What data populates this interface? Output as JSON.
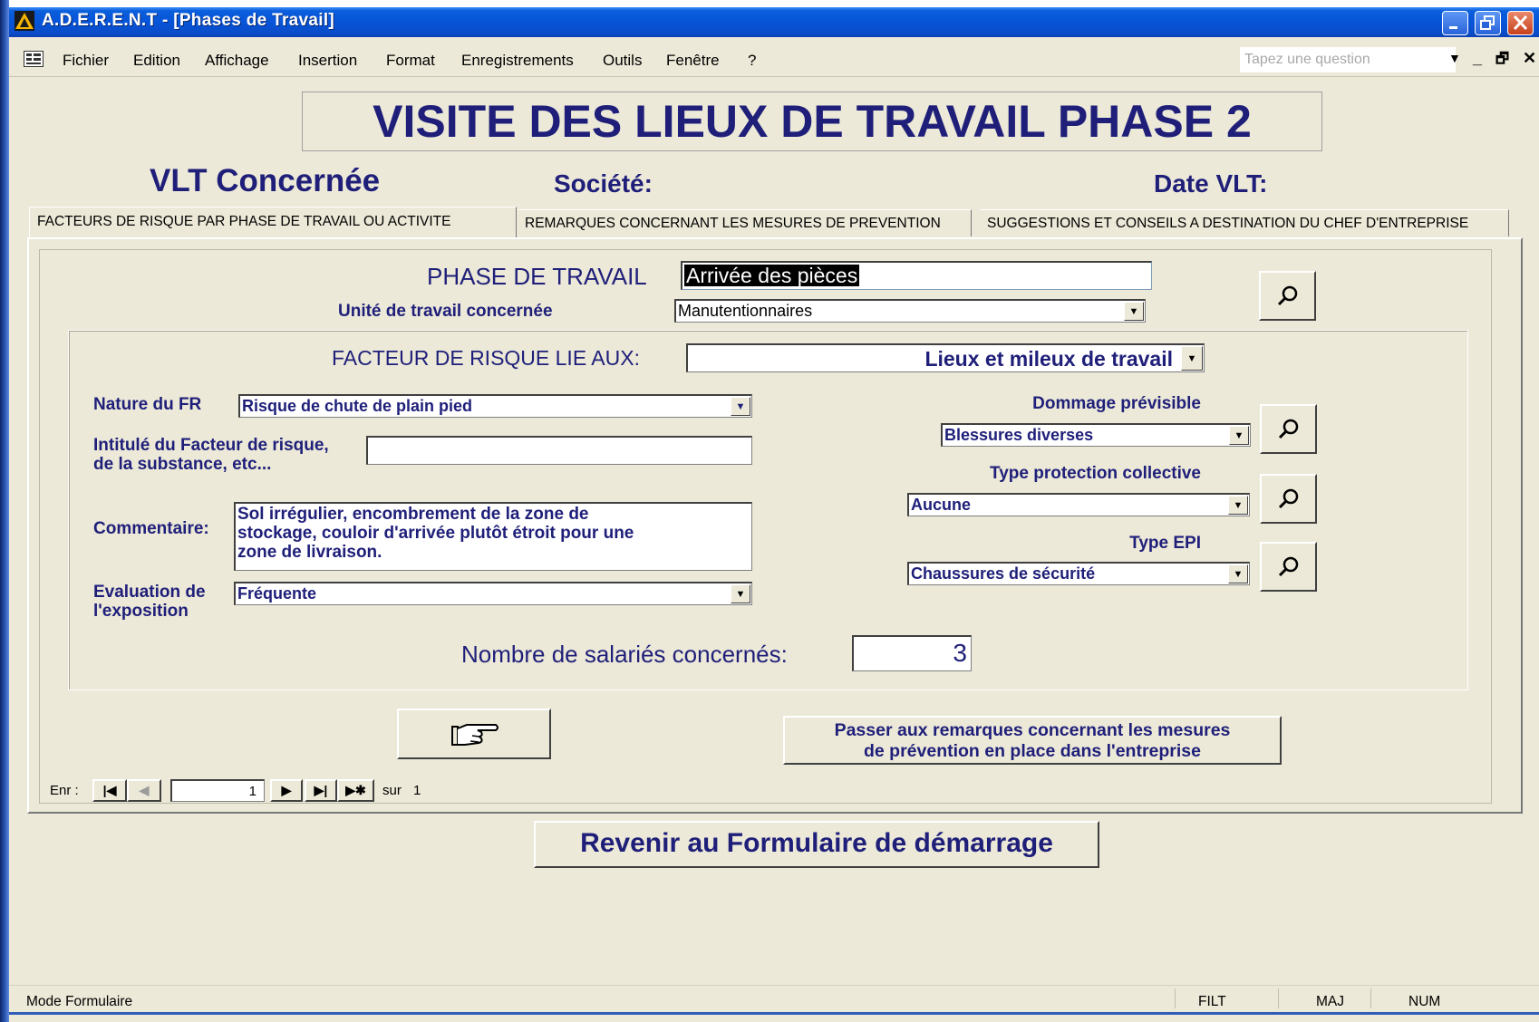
{
  "window": {
    "title": "A.D.E.R.E.N.T - [Phases de Travail]",
    "colors": {
      "titlebar": "#0754d8",
      "form_text": "#1f1f7a",
      "form_bg": "#ece9d8"
    }
  },
  "menu": {
    "items": [
      "Fichier",
      "Edition",
      "Affichage",
      "Insertion",
      "Format",
      "Enregistrements",
      "Outils",
      "Fenêtre",
      "?"
    ],
    "question_placeholder": "Tapez une question"
  },
  "header": {
    "title": "VISITE DES LIEUX DE TRAVAIL PHASE 2",
    "vlt_label": "VLT Concernée",
    "societe_label": "Société:",
    "date_label": "Date VLT:"
  },
  "tabs": [
    {
      "label": "FACTEURS DE RISQUE PAR PHASE DE TRAVAIL OU ACTIVITE",
      "active": true
    },
    {
      "label": "REMARQUES CONCERNANT LES MESURES DE PREVENTION",
      "active": false
    },
    {
      "label": "SUGGESTIONS ET CONSEILS A DESTINATION DU CHEF D'ENTREPRISE",
      "active": false
    }
  ],
  "form": {
    "phase_label": "PHASE DE TRAVAIL",
    "phase_value": "Arrivée des pièces",
    "unite_label": "Unité de travail concernée",
    "unite_value": "Manutentionnaires",
    "facteur_label": "FACTEUR DE RISQUE LIE AUX:",
    "facteur_value": "Lieux et mileux de travail",
    "nature_label": "Nature du FR",
    "nature_value": "Risque de chute de plain pied",
    "intitule_label_1": "Intitulé du Facteur de risque,",
    "intitule_label_2": "de la substance, etc...",
    "intitule_value": "",
    "comment_label": "Commentaire:",
    "comment_lines": [
      "Sol irrégulier, encombrement de la zone de",
      "stockage, couloir d'arrivée plutôt étroit pour une",
      "zone de livraison."
    ],
    "eval_label_1": "Evaluation de",
    "eval_label_2": "l'exposition",
    "eval_value": "Fréquente",
    "dommage_label": "Dommage prévisible",
    "dommage_value": "Blessures diverses",
    "protcol_label": "Type protection collective",
    "protcol_value": "Aucune",
    "epi_label": "Type EPI",
    "epi_value": "Chaussures de sécurité",
    "nb_label": "Nombre de salariés concernés:",
    "nb_value": "3",
    "next_button_line1": "Passer aux remarques concernant les mesures",
    "next_button_line2": "de prévention en place dans l'entreprise"
  },
  "navigator": {
    "label": "Enr :",
    "current": "1",
    "total_label": "sur",
    "total": "1"
  },
  "back_button": "Revenir au Formulaire de démarrage",
  "status": {
    "mode": "Mode Formulaire",
    "indicators": [
      "FILT",
      "MAJ",
      "NUM"
    ]
  },
  "icons": {
    "lookup": "magnifier-icon",
    "hand": "pointing-hand-icon"
  }
}
